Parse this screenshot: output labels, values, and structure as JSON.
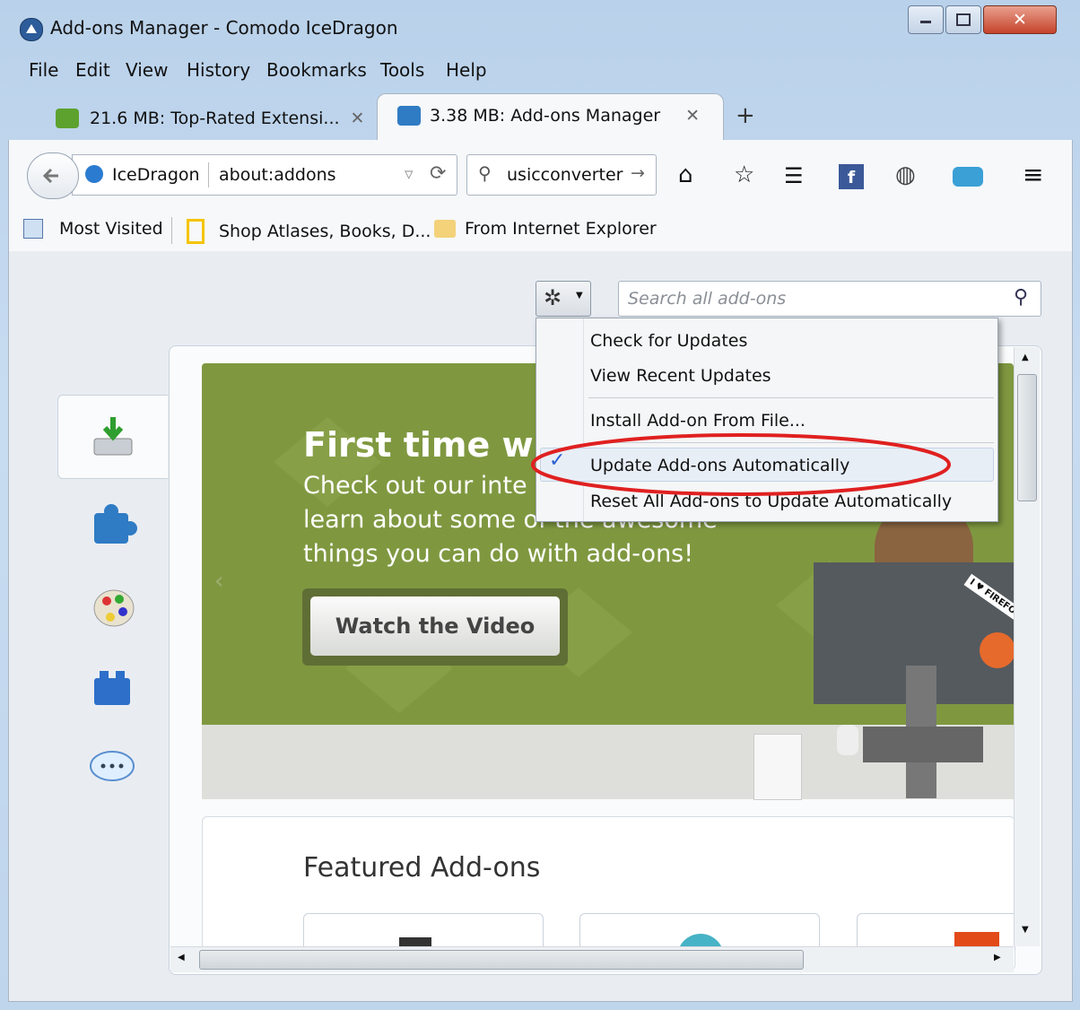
{
  "window": {
    "title": "Add-ons Manager - Comodo IceDragon"
  },
  "menubar": [
    "File",
    "Edit",
    "View",
    "History",
    "Bookmarks",
    "Tools",
    "Help"
  ],
  "tabs": [
    {
      "label": "21.6 MB: Top-Rated Extensi..."
    },
    {
      "label": "3.38 MB: Add-ons Manager"
    }
  ],
  "urlbar": {
    "identity": "IceDragon",
    "url": "about:addons"
  },
  "searchbar": {
    "value": "usicconverter"
  },
  "bookmarks": [
    "Most Visited",
    "Shop Atlases, Books, D...",
    "From Internet Explorer"
  ],
  "addons_search": {
    "placeholder": "Search all add-ons"
  },
  "tools_menu": {
    "items": [
      "Check for Updates",
      "View Recent Updates",
      "Install Add-on From File...",
      "Update Add-ons Automatically",
      "Reset All Add-ons to Update Automatically"
    ],
    "checked_item": "Update Add-ons Automatically"
  },
  "banner": {
    "headline": "First time wi",
    "body_line1": "Check out our inte",
    "body_line2": "learn about some of the awesome",
    "body_line3": "things you can do with add-ons!",
    "button": "Watch the Video",
    "sticker": "I ♥ FIREFOX"
  },
  "featured": {
    "heading": "Featured Add-ons"
  },
  "colors": {
    "highlight_ellipse": "#e02020",
    "banner_green": "#7f9840",
    "check": "#2a5fd0"
  }
}
